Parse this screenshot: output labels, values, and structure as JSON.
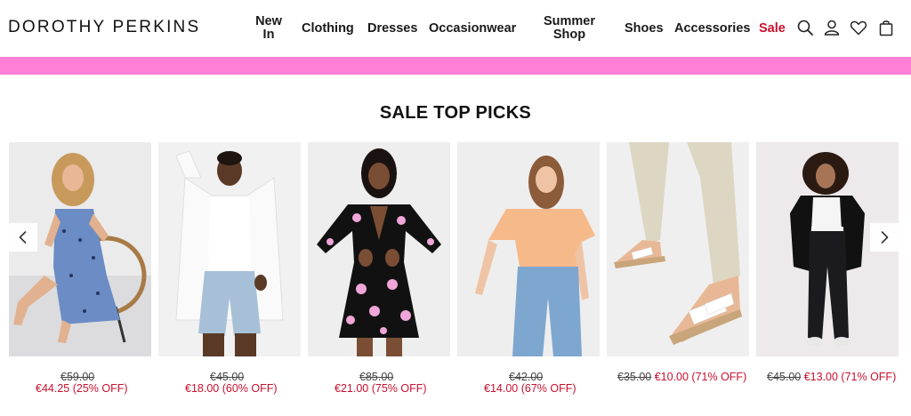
{
  "brand": {
    "logo_text": "DOROTHY PERKINS"
  },
  "nav": {
    "new_in": "New In",
    "clothing": "Clothing",
    "dresses": "Dresses",
    "occasionwear": "Occasionwear",
    "summer_shop": "Summer Shop",
    "shoes": "Shoes",
    "accessories": "Accessories",
    "sale": "Sale"
  },
  "icons": [
    "search-icon",
    "account-icon",
    "wishlist-heart-icon",
    "shopping-bag-icon",
    "chevron-left-icon",
    "chevron-right-icon"
  ],
  "colors": {
    "banner": "#ff7fd6",
    "sale_red": "#c8102e"
  },
  "section": {
    "title": "SALE TOP PICKS"
  },
  "products": [
    {
      "image": "woman in blue floral ruffle sundress seated on rattan chair",
      "was": "€59.00",
      "now": "€44.25 (25% OFF)"
    },
    {
      "image": "woman in white shirt and light denim shorts",
      "was": "€45.00",
      "now": "€18.00 (60% OFF)"
    },
    {
      "image": "woman in black and pink polka dot cut-out dress",
      "was": "€85.00",
      "now": "€21.00 (75% OFF)"
    },
    {
      "image": "woman in peach t-shirt and blue jeans",
      "was": "€42.00",
      "now": "€14.00 (67% OFF)"
    },
    {
      "image": "white strap flat sandals worn with cream trousers",
      "was": "€35.00",
      "now": "€10.00 (71% OFF)"
    },
    {
      "image": "woman in black blazer, white top and black jeans",
      "was": "€45.00",
      "now": "€13.00 (71% OFF)"
    }
  ]
}
